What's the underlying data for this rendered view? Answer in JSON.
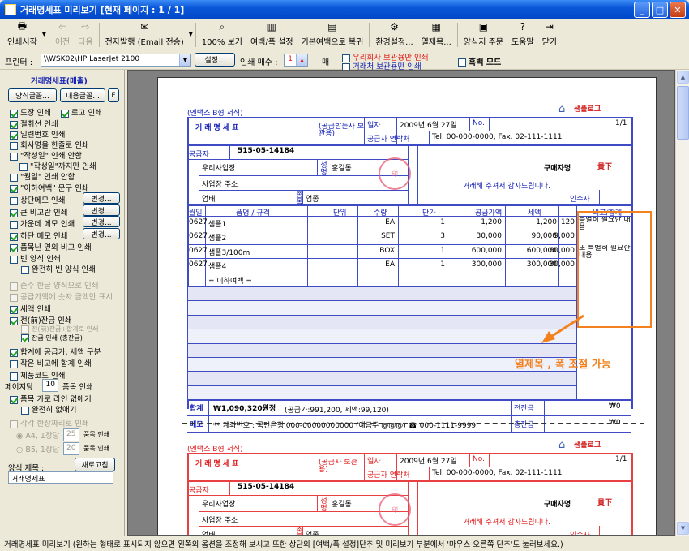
{
  "window": {
    "title": "거래명세표 미리보기 [현재 페이지 : 1 / 1]"
  },
  "toolbar": {
    "items": [
      {
        "label": "인쇄시작",
        "icon": "printer-icon",
        "enabled": true
      },
      {
        "label": "이전",
        "icon": "arrow-left-icon",
        "enabled": false
      },
      {
        "label": "다음",
        "icon": "arrow-right-icon",
        "enabled": false
      },
      {
        "label": "전자발행 (Email 전송)",
        "icon": "email-icon",
        "enabled": true
      },
      {
        "label": "100% 보기",
        "icon": "zoom-icon",
        "enabled": true
      },
      {
        "label": "여백/폭 설정",
        "icon": "margin-icon",
        "enabled": true
      },
      {
        "label": "기본여백으로 복귀",
        "icon": "reset-margin-icon",
        "enabled": true
      },
      {
        "label": "환경설정...",
        "icon": "gear-icon",
        "enabled": true
      },
      {
        "label": "열제목...",
        "icon": "columns-icon",
        "enabled": true
      },
      {
        "label": "양식지 주문",
        "icon": "order-icon",
        "enabled": true
      },
      {
        "label": "도움말",
        "icon": "help-icon",
        "enabled": true
      },
      {
        "label": "닫기",
        "icon": "exit-icon",
        "enabled": true
      }
    ]
  },
  "options": {
    "printer_label": "프린터 :",
    "printer_value": "\\\\WSK02\\HP LaserJet 2100",
    "settings_label": "설정...",
    "copies_label": "인쇄 매수 :",
    "copies_value": "1",
    "copies_unit": "매",
    "own_only": "우리회사 보관용만 인쇄",
    "client_only": "거래처 보관용만 인쇄",
    "mono": "흑백 모드"
  },
  "sidebar": {
    "heading": "거래명세표(매출)",
    "btn_style": "양식글꼴...",
    "btn_content": "내용글꼴...",
    "btn_f": "F",
    "checks": [
      {
        "label": "도장 인쇄",
        "on": true
      },
      {
        "label": "로고 인쇄",
        "on": true
      },
      {
        "label": "절취선 인쇄",
        "on": true
      },
      {
        "label": "일련번호 인쇄",
        "on": true
      },
      {
        "label": "회사명을 한줄로 인쇄",
        "on": false
      },
      {
        "label": "\"작성일\" 인쇄 안함",
        "on": false
      },
      {
        "label": "\"작성일\"까지만 인쇄",
        "on": false
      },
      {
        "label": "\"월일\" 인쇄 안함",
        "on": false
      },
      {
        "label": "\"이하여백\" 문구 인쇄",
        "on": true
      },
      {
        "label": "상단메모 인쇄",
        "on": false
      },
      {
        "label": "큰 비고란 인쇄",
        "on": true
      },
      {
        "label": "가운데 메모 인쇄",
        "on": false
      },
      {
        "label": "하단 메모 인쇄",
        "on": true
      },
      {
        "label": "품목난 옆의 비고 인쇄",
        "on": true
      },
      {
        "label": "빈 양식 인쇄",
        "on": false
      },
      {
        "label": "완전히 빈 양식 인쇄",
        "on": false
      },
      {
        "label": "순수 한글 양식으로 인쇄",
        "on": false
      },
      {
        "label": "공급가액에 숫자 금액만 표시",
        "on": false
      },
      {
        "label": "세액 인쇄",
        "on": true
      },
      {
        "label": "전(前)잔금 인쇄",
        "on": true
      },
      {
        "label": "전(前)잔금+합계로 인쇄",
        "on": false
      },
      {
        "label": "잔금 인쇄 (총잔금)",
        "on": true
      },
      {
        "label": "합계에 공급가, 세액 구분",
        "on": true
      },
      {
        "label": "작은 비고에 합계 인쇄",
        "on": false
      },
      {
        "label": "제품코드 인쇄",
        "on": false
      }
    ],
    "change_btn": "변경...",
    "per_page_label": "페이지당",
    "per_page_value": "10",
    "per_page_unit": "품목 인쇄",
    "no_lines": "품목 가로 라인 없애기",
    "no_lines_full": "완전히 없애기",
    "half_page": "각각 한장짜리로 인쇄",
    "a4_label": "A4, 1장당",
    "a4_value": "25",
    "a4_unit": "품목 인쇄",
    "b5_label": "B5, 1장당",
    "b5_value": "20",
    "b5_unit": "품목 인쇄",
    "title_label": "양식 제목 :",
    "refresh_btn": "새로고침",
    "title_value": "거래명세표"
  },
  "doc": {
    "form_caption": "(엔택스 B형 서식)",
    "logo": "샘플로고",
    "title": "거래명세표",
    "copy_blue": "(공급받는자 보관용)",
    "copy_red": "(공급자 보관용)",
    "date_label": "일자",
    "date_value": "2009년 6월 27일",
    "no_label": "No.",
    "page_value": "1/1",
    "contact_label": "공급자 연락처",
    "contact_value": "Tel. 00-000-0000, Fax. 02-111-1111",
    "supplier_label": "공급자",
    "reg_no": "515-05-14184",
    "company": "우리사업장",
    "rep_label": "성명",
    "rep": "홍길동",
    "address": "사업장 주소",
    "biz_type": "업태",
    "biz_item": "업종",
    "biz_item_label": "종목",
    "buyer_label": "구매자명",
    "buyer": "貴下",
    "thanks": "거래해 주셔서 감사드립니다.",
    "inspector": "인수자",
    "columns": [
      "월일",
      "품명 / 규격",
      "단위",
      "수량",
      "단가",
      "공급가액",
      "세액",
      "비고/합계"
    ],
    "rows": [
      {
        "date": "0627",
        "name": "샘플1",
        "unit": "EA",
        "qty": "1",
        "price": "1,200",
        "amount": "1,200",
        "tax": "120",
        "note": "특별히 필요한 내용"
      },
      {
        "date": "0627",
        "name": "샘플2",
        "unit": "SET",
        "qty": "3",
        "price": "30,000",
        "amount": "90,000",
        "tax": "9,000",
        "note": ""
      },
      {
        "date": "0627",
        "name": "샘플3/100m",
        "unit": "BOX",
        "qty": "1",
        "price": "600,000",
        "amount": "600,000",
        "tax": "60,000",
        "note": "또 특별히 필요한 내용"
      },
      {
        "date": "0627",
        "name": "샘플4",
        "unit": "EA",
        "qty": "1",
        "price": "300,000",
        "amount": "300,000",
        "tax": "30,000",
        "note": ""
      }
    ],
    "below": "= 이하여백 =",
    "total_label": "합계",
    "total_value": "₩1,090,320원정",
    "total_detail": "(공급가:991,200, 세액:99,120)",
    "prev_bal_label": "전잔금",
    "prev_bal": "₩0",
    "memo_label": "메모",
    "memo": "** 계좌번호 : 국민은행 000-00000000000 (예금주 @@@)  ☎ 000-1111-9999",
    "bal_label": "총잔금",
    "bal": "₩0",
    "callout_text": "열제목 , 폭 조절 가능"
  },
  "status": "거래명세표 미리보기 (원하는 형태로 표시되지 않으면 왼쪽의 옵션을 조정해 보시고 또한 상단의 [여백/폭 설정]단추 및 미리보기 부분에서 '마우스 오른쪽 단추'도 눌러보세요.)",
  "colors": {
    "blue_form": "#1420b4",
    "red_form": "#e01818",
    "callout": "#f2811e",
    "titlebar": "#0a58d8"
  }
}
